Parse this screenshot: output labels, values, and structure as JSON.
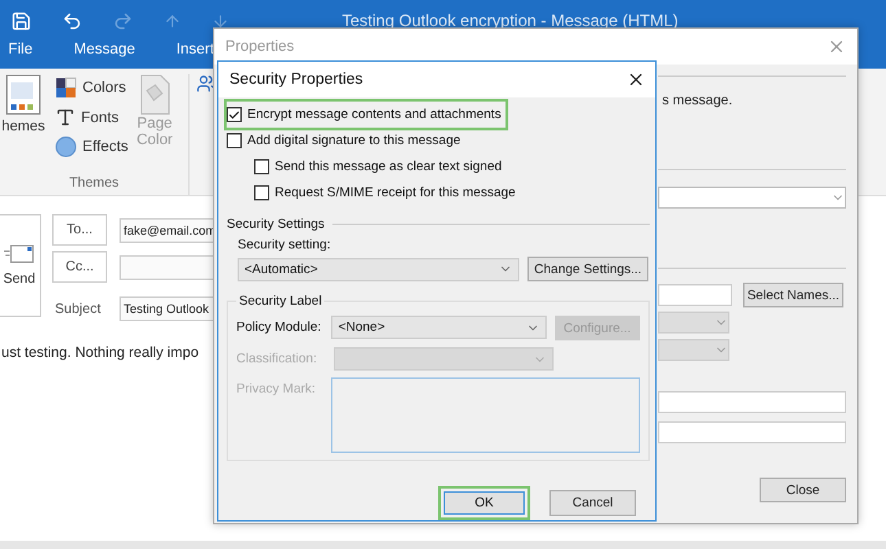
{
  "window": {
    "title": "Testing Outlook encryption - Message (HTML)"
  },
  "ribbon_tabs": [
    {
      "label": "File"
    },
    {
      "label": "Message"
    },
    {
      "label": "Insert"
    }
  ],
  "ribbon": {
    "themes_button": "hemes",
    "items": [
      {
        "label": "Colors"
      },
      {
        "label": "Fonts"
      },
      {
        "label": "Effects"
      }
    ],
    "page_color": {
      "line1": "Page",
      "line2": "Color",
      "disabled": true
    },
    "group_label": "Themes"
  },
  "compose": {
    "send": "Send",
    "to_button": "To...",
    "to_value": "fake@email.com",
    "cc_button": "Cc...",
    "subject_label": "Subject",
    "subject_value": "Testing Outlook",
    "body": "ust testing. Nothing really impo"
  },
  "properties": {
    "title": "Properties",
    "text": "s message.",
    "select_names": "Select Names...",
    "close": "Close"
  },
  "security": {
    "title": "Security Properties",
    "options": [
      {
        "label": "Encrypt message contents and attachments",
        "checked": true,
        "highlighted": true
      },
      {
        "label": "Add digital signature to this message",
        "checked": false,
        "highlighted": false,
        "children": [
          {
            "label": "Send this message as clear text signed",
            "checked": false,
            "highlighted": false
          },
          {
            "label": "Request S/MIME receipt for this message",
            "checked": false,
            "highlighted": false
          }
        ]
      }
    ],
    "settings_group": "Security Settings",
    "setting_label": "Security setting:",
    "setting_value": "<Automatic>",
    "change_settings": "Change Settings...",
    "label_group": "Security Label",
    "policy_label": "Policy Module:",
    "policy_value": "<None>",
    "configure": {
      "label": "Configure...",
      "disabled": true
    },
    "classification": {
      "label": "Classification:",
      "disabled": true
    },
    "privacy": {
      "label": "Privacy Mark:",
      "disabled": true
    },
    "ok": {
      "label": "OK",
      "highlighted": true
    },
    "cancel": "Cancel"
  }
}
